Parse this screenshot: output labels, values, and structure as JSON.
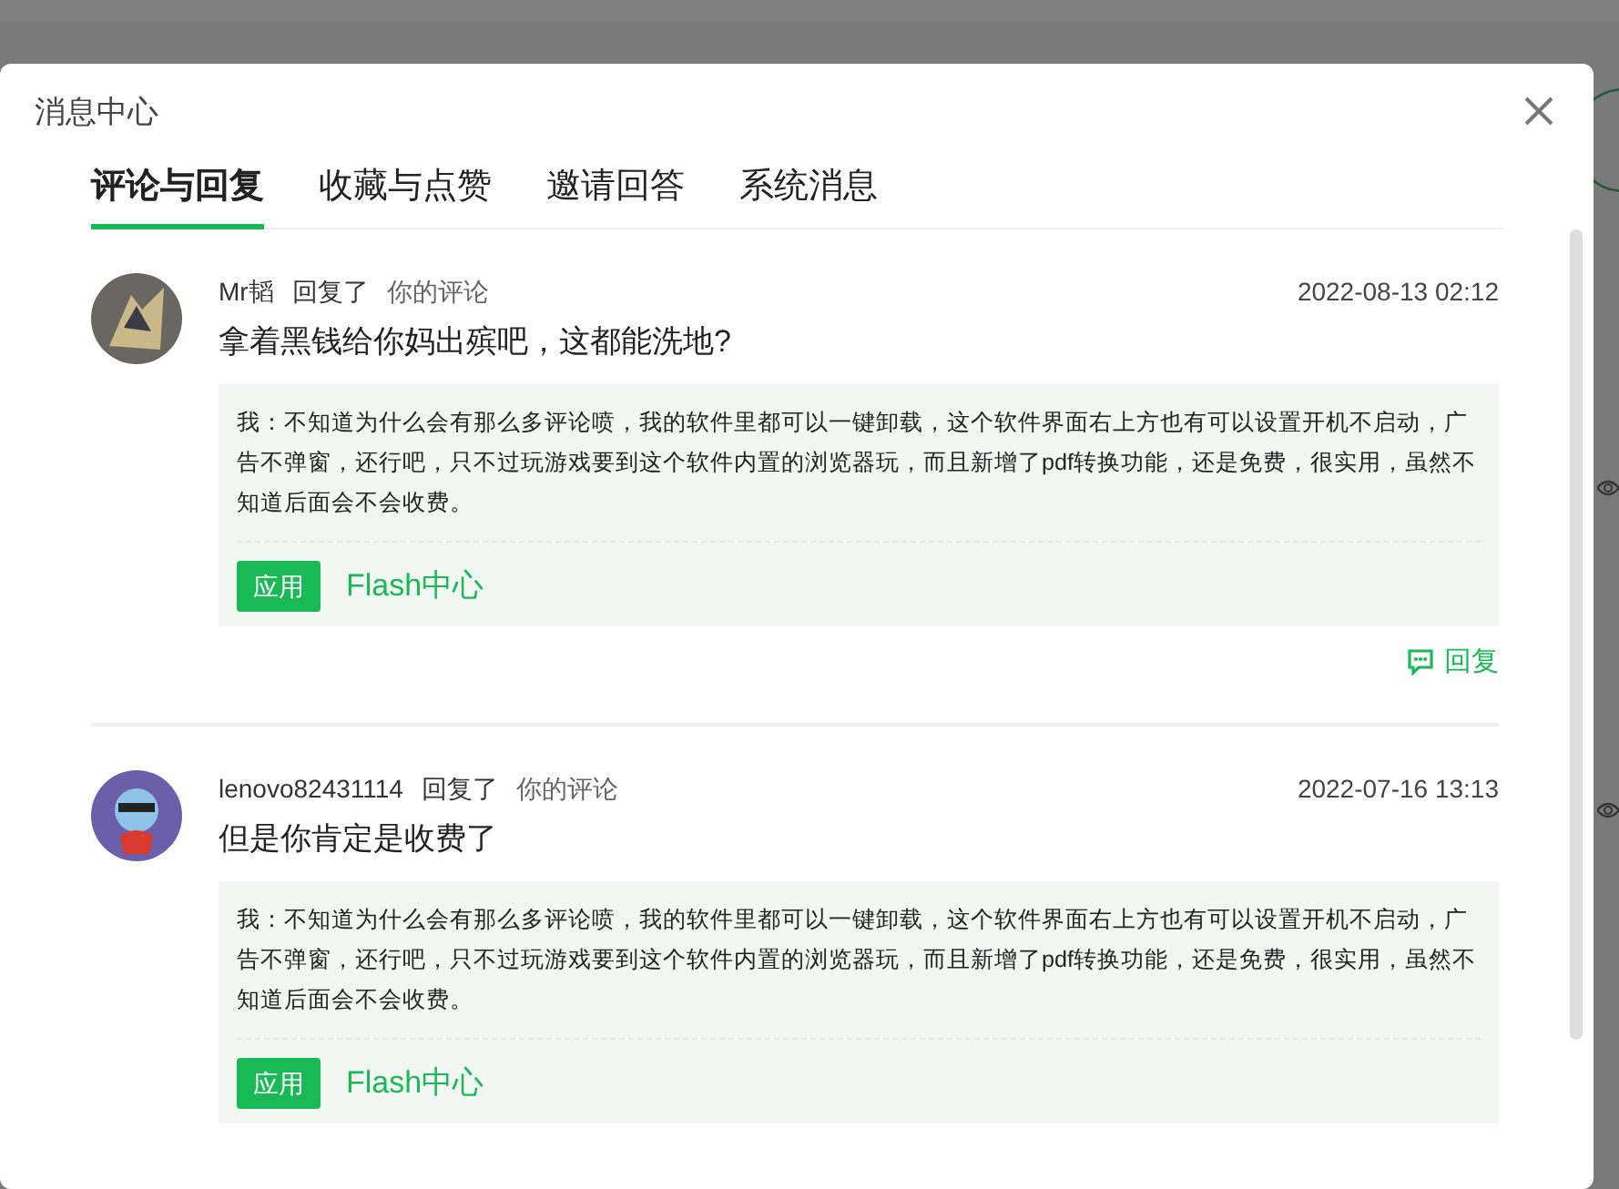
{
  "dialog": {
    "title": "消息中心"
  },
  "tabs": [
    {
      "label": "评论与回复",
      "selected": true
    },
    {
      "label": "收藏与点赞",
      "selected": false
    },
    {
      "label": "邀请回答",
      "selected": false
    },
    {
      "label": "系统消息",
      "selected": false
    }
  ],
  "messages": [
    {
      "user": "Mr韬",
      "action": "回复了",
      "target": "你的评论",
      "time": "2022-08-13 02:12",
      "text": "拿着黑钱给你妈出殡吧，这都能洗地?",
      "quote": "我：不知道为什么会有那么多评论喷，我的软件里都可以一键卸载，这个软件界面右上方也有可以设置开机不启动，广告不弹窗，还行吧，只不过玩游戏要到这个软件内置的浏览器玩，而且新增了pdf转换功能，还是免费，很实用，虽然不知道后面会不会收费。",
      "tag": "应用",
      "app": "Flash中心",
      "reply": "回复"
    },
    {
      "user": "lenovo82431114",
      "action": "回复了",
      "target": "你的评论",
      "time": "2022-07-16 13:13",
      "text": "但是你肯定是收费了",
      "quote": "我：不知道为什么会有那么多评论喷，我的软件里都可以一键卸载，这个软件界面右上方也有可以设置开机不启动，广告不弹窗，还行吧，只不过玩游戏要到这个软件内置的浏览器玩，而且新增了pdf转换功能，还是免费，很实用，虽然不知道后面会不会收费。",
      "tag": "应用",
      "app": "Flash中心"
    }
  ]
}
